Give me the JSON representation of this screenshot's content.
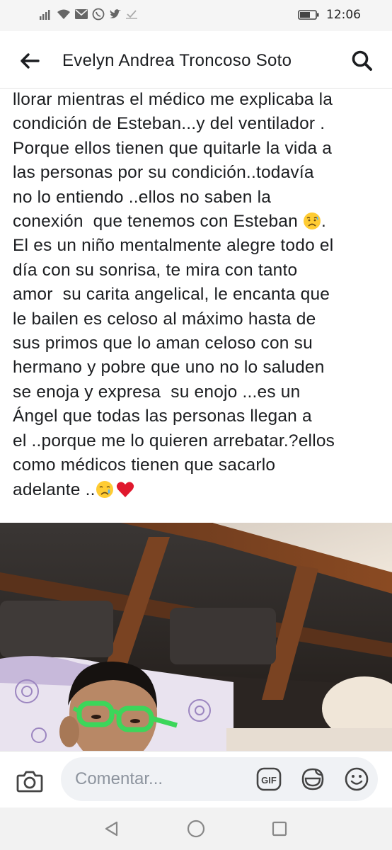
{
  "status_bar": {
    "time": "12:06",
    "icons": [
      "signal-icon",
      "wifi-icon",
      "mail-icon",
      "whatsapp-icon",
      "twitter-icon",
      "check-icon",
      "battery-icon"
    ]
  },
  "header": {
    "title": "Evelyn Andrea Troncoso Soto",
    "back_icon": "arrow-left-icon",
    "search_icon": "search-icon"
  },
  "post": {
    "lines": [
      "llorar mientras el médico me explicaba la",
      "condición de Esteban...y del ventilador .",
      "Porque ellos tienen que quitarle la vida a",
      "las personas por su condición..todavía",
      "no lo entiendo ..ellos no saben la",
      "conexión  que tenemos con Esteban ",
      "El es un niño mentalmente alegre todo el",
      "día con su sonrisa, te mira con tanto",
      "amor  su carita angelical, le encanta que",
      "le bailen es celoso al máximo hasta de",
      "sus primos que lo aman celoso con su",
      "hermano y pobre que uno no lo saluden",
      "se enoja y expresa  su enojo ...es un",
      "Ángel que todas las personas llegan a",
      "el ..porque me lo quieren arrebatar.?ellos",
      "como médicos tienen que sacarlo",
      "adelante .."
    ],
    "line6_suffix": ".",
    "emojis": [
      "sad-relieved-face-emoji",
      "crying-face-emoji",
      "red-heart-emoji"
    ]
  },
  "photo": {
    "subject": "boy-with-green-glasses-photo"
  },
  "comment_bar": {
    "placeholder": "Comentar...",
    "gif_label": "GIF"
  },
  "nav_bar": {
    "buttons": [
      "back-triangle-icon",
      "home-circle-icon",
      "recents-square-icon"
    ]
  },
  "colors": {
    "text": "#1c1e21",
    "placeholder": "#8d949e",
    "glasses_green": "#3cd65a",
    "heart_red": "#e0182d"
  }
}
